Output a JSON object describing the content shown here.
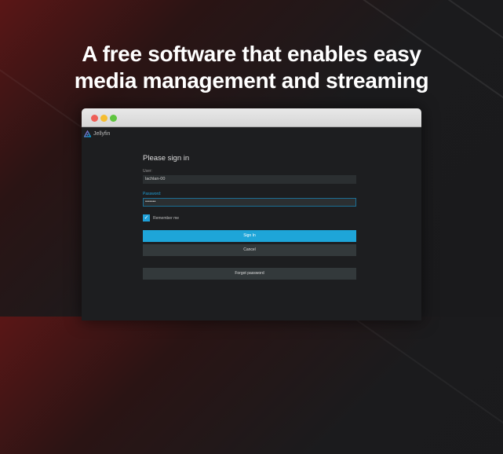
{
  "headline": {
    "line1": "A free software  that enables easy",
    "line2": "media management and streaming"
  },
  "window": {
    "buttons": {
      "close": "#ee5f57",
      "minimize": "#f5bd30",
      "zoom": "#5fc53f"
    }
  },
  "app": {
    "name": "Jellyfin",
    "logo_icon": "jellyfin-triangle-icon"
  },
  "login": {
    "title": "Please sign in",
    "user_label": "User:",
    "user_value": "lachlan-00",
    "password_label": "Password:",
    "password_value": "•••••••",
    "remember_label": "Remember me",
    "remember_checked": true,
    "sign_in": "Sign In",
    "cancel": "Cancel",
    "forgot": "Forgot password"
  },
  "colors": {
    "accent": "#1ea5d8",
    "background": "#1d1e20"
  }
}
